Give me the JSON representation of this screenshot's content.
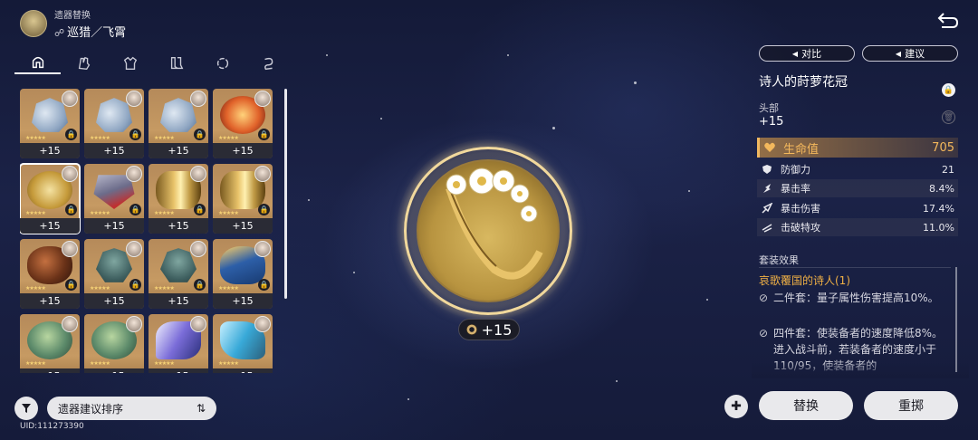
{
  "header": {
    "title": "遗器替换",
    "path_icon": "path-of-nihility-icon",
    "subtitle": "巡猎／飞霄"
  },
  "tabs": [
    {
      "name": "head-tab",
      "icon": "helmet-icon",
      "active": true
    },
    {
      "name": "hands-tab",
      "icon": "gloves-icon",
      "active": false
    },
    {
      "name": "body-tab",
      "icon": "armor-icon",
      "active": false
    },
    {
      "name": "feet-tab",
      "icon": "boots-icon",
      "active": false
    },
    {
      "name": "sphere-tab",
      "icon": "planar-sphere-icon",
      "active": false
    },
    {
      "name": "rope-tab",
      "icon": "link-rope-icon",
      "active": false
    }
  ],
  "relics": [
    {
      "type": "helm",
      "level": "+15",
      "locked": true,
      "selected": false
    },
    {
      "type": "helm",
      "level": "+15",
      "locked": true,
      "selected": false
    },
    {
      "type": "helm",
      "level": "+15",
      "locked": true,
      "selected": false
    },
    {
      "type": "fire",
      "level": "+15",
      "locked": true,
      "selected": false
    },
    {
      "type": "flower",
      "level": "+15",
      "locked": true,
      "selected": true
    },
    {
      "type": "mask",
      "level": "+15",
      "locked": true,
      "selected": false
    },
    {
      "type": "gold",
      "level": "+15",
      "locked": true,
      "selected": false
    },
    {
      "type": "gold",
      "level": "+15",
      "locked": true,
      "selected": false
    },
    {
      "type": "rock",
      "level": "+15",
      "locked": true,
      "selected": false
    },
    {
      "type": "dragon",
      "level": "+15",
      "locked": true,
      "selected": false
    },
    {
      "type": "dragon",
      "level": "+15",
      "locked": true,
      "selected": false
    },
    {
      "type": "blue",
      "level": "+15",
      "locked": true,
      "selected": false
    },
    {
      "type": "egg",
      "level": "+15",
      "locked": false,
      "selected": false
    },
    {
      "type": "egg",
      "level": "+15",
      "locked": false,
      "selected": false
    },
    {
      "type": "ribbon",
      "level": "+15",
      "locked": false,
      "selected": false
    },
    {
      "type": "wave",
      "level": "+15",
      "locked": false,
      "selected": false
    }
  ],
  "sort": {
    "label": "遗器建议排序"
  },
  "uid": "UID:111273390",
  "center": {
    "level": "+15"
  },
  "buttons": {
    "compare": "对比",
    "suggest": "建议",
    "replace": "替换",
    "reset": "重掷"
  },
  "detail": {
    "name": "诗人的莳萝花冠",
    "slot": "头部",
    "level": "+15",
    "main_stat": {
      "name": "生命值",
      "value": "705"
    },
    "sub_stats": [
      {
        "icon": "defense-icon",
        "name": "防御力",
        "value": "21"
      },
      {
        "icon": "crit-rate-icon",
        "name": "暴击率",
        "value": "8.4%"
      },
      {
        "icon": "crit-damage-icon",
        "name": "暴击伤害",
        "value": "17.4%"
      },
      {
        "icon": "break-effect-icon",
        "name": "击破特攻",
        "value": "11.0%"
      }
    ],
    "set_title": "套装效果",
    "set_name": "哀歌覆国的诗人(1)",
    "set_effects": [
      "二件套：量子属性伤害提高10%。",
      "四件套：使装备者的速度降低8%。进入战斗前，若装备者的速度小于110/95，使装备者的"
    ]
  },
  "colors": {
    "accent": "#f4b85c",
    "set_name": "#f0b045",
    "card_bg": "#c69a63"
  }
}
